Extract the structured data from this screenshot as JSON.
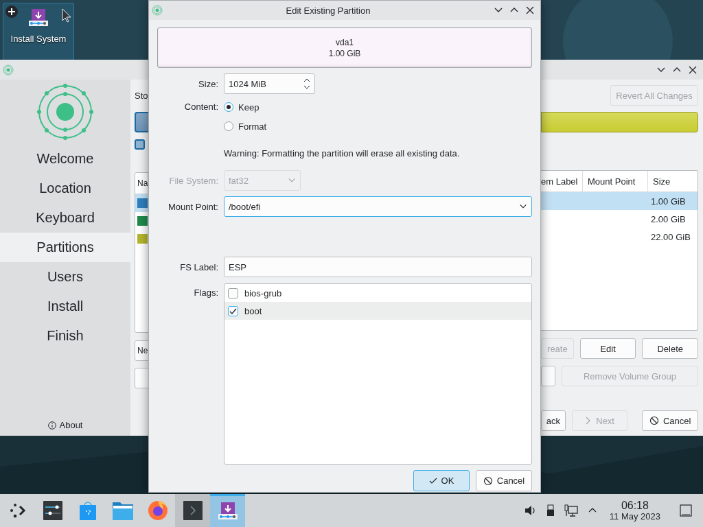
{
  "desktop": {
    "icon_label": "Install System"
  },
  "installer": {
    "sidebar": [
      {
        "label": "Welcome",
        "selected": false
      },
      {
        "label": "Location",
        "selected": false
      },
      {
        "label": "Keyboard",
        "selected": false
      },
      {
        "label": "Partitions",
        "selected": true
      },
      {
        "label": "Users",
        "selected": false
      },
      {
        "label": "Install",
        "selected": false
      },
      {
        "label": "Finish",
        "selected": false
      }
    ],
    "about": "About",
    "storage_label": "Sto",
    "option_checkbox": {
      "checked": false
    },
    "revert_button": {
      "label": "Revert All Changes",
      "disabled": true
    },
    "table": {
      "columns": [
        "Na",
        "em Label",
        "Mount Point",
        "Size"
      ],
      "rows": [
        {
          "color": "#2e7fbd",
          "size": "1.00 GiB",
          "selected": true
        },
        {
          "color": "#1f8a4c",
          "size": "2.00 GiB",
          "selected": false
        },
        {
          "color": "#b3b52c",
          "size": "22.00 GiB",
          "selected": false
        }
      ]
    },
    "left_button": {
      "label": "Ne"
    },
    "partition_buttons": [
      {
        "label": "reate",
        "disabled": true
      },
      {
        "label": "Edit",
        "disabled": false
      },
      {
        "label": "Delete",
        "disabled": false
      }
    ],
    "volume_button": {
      "label": "Remove Volume Group",
      "disabled": true
    },
    "nav_buttons": [
      {
        "label": "ack",
        "kind": "plain",
        "disabled": false
      },
      {
        "label": "Next",
        "kind": "next",
        "disabled": true
      },
      {
        "label": "Cancel",
        "kind": "cancel",
        "disabled": false
      }
    ]
  },
  "dialog": {
    "title": "Edit Existing Partition",
    "partition": {
      "name": "vda1",
      "size": "1.00 GiB"
    },
    "size": {
      "label": "Size:",
      "value": "1024 MiB"
    },
    "content": {
      "label": "Content:",
      "options": [
        {
          "label": "Keep",
          "selected": true
        },
        {
          "label": "Format",
          "selected": false
        }
      ]
    },
    "warning": "Warning: Formatting the partition will erase all existing data.",
    "file_system": {
      "label": "File System:",
      "value": "fat32",
      "disabled": true
    },
    "mount_point": {
      "label": "Mount Point:",
      "value": "/boot/efi"
    },
    "fs_label": {
      "label": "FS Label:",
      "value": "ESP"
    },
    "flags": {
      "label": "Flags:",
      "items": [
        {
          "label": "bios-grub",
          "checked": false,
          "selected": false
        },
        {
          "label": "boot",
          "checked": true,
          "selected": true
        }
      ]
    },
    "buttons": [
      {
        "label": "OK",
        "kind": "ok",
        "default": true
      },
      {
        "label": "Cancel",
        "kind": "cancel",
        "default": false
      }
    ]
  },
  "taskbar": {
    "tasks": [
      {
        "kind": "settings",
        "active": false
      },
      {
        "kind": "store",
        "active": false
      },
      {
        "kind": "files",
        "active": false
      },
      {
        "kind": "browser",
        "active": false
      },
      {
        "kind": "terminal",
        "active": true
      },
      {
        "kind": "installer",
        "active": true
      }
    ],
    "clock": {
      "time": "06:18",
      "date": "11 May 2023"
    }
  }
}
